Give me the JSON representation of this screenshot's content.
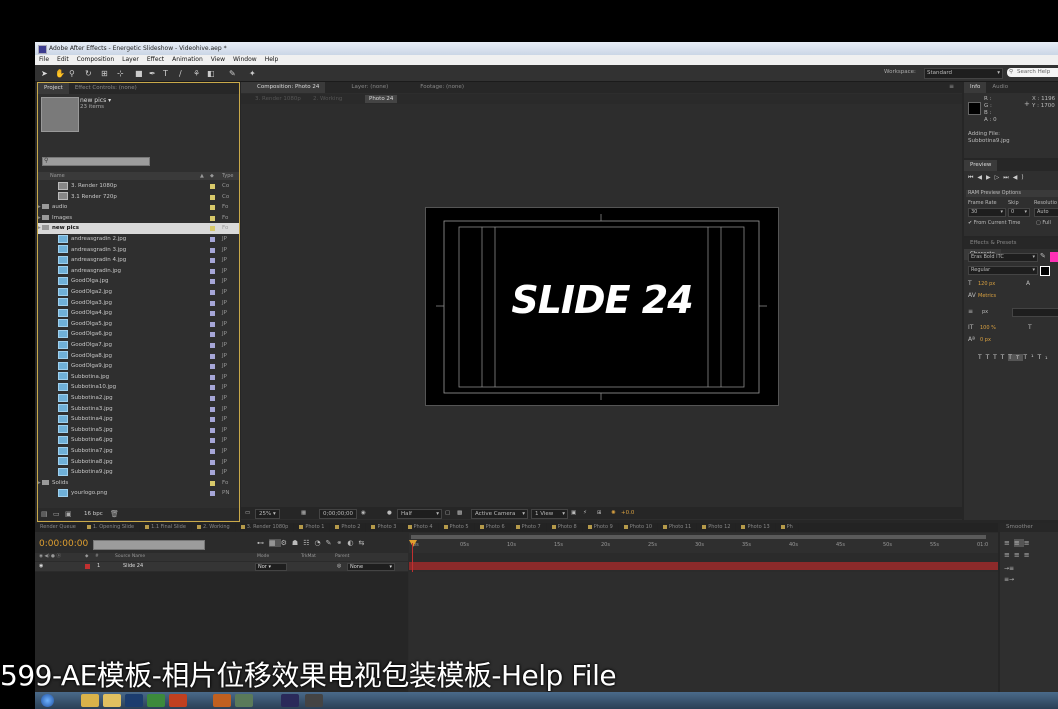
{
  "window": {
    "title": "Adobe After Effects - Energetic Slideshow - Videohive.aep *",
    "menu": [
      "File",
      "Edit",
      "Composition",
      "Layer",
      "Effect",
      "Animation",
      "View",
      "Window",
      "Help"
    ],
    "workspace_label": "Workspace:",
    "workspace_value": "Standard",
    "search_placeholder": "Search Help"
  },
  "project": {
    "tabs": [
      "Project",
      "Effect Controls: (none)"
    ],
    "selected_name": "new pics ▾",
    "selected_count": "23 items",
    "col_name": "Name",
    "col_type": "Type",
    "items": [
      {
        "name": "3. Render 1080p",
        "kind": "comp",
        "indent": 2,
        "type": "Co",
        "label": "y"
      },
      {
        "name": "3.1 Render 720p",
        "kind": "comp",
        "indent": 2,
        "type": "Co",
        "label": "y"
      },
      {
        "name": "audio",
        "kind": "folder",
        "indent": 0,
        "type": "Fo",
        "label": "y"
      },
      {
        "name": "Images",
        "kind": "folder",
        "indent": 0,
        "type": "Fo",
        "label": "y"
      },
      {
        "name": "new pics",
        "kind": "folder",
        "indent": 0,
        "type": "Fo",
        "label": "y",
        "selected": true
      },
      {
        "name": "andreasgradin 2.jpg",
        "kind": "img",
        "indent": 1,
        "type": "JP",
        "label": "p"
      },
      {
        "name": "andreasgradin 3.jpg",
        "kind": "img",
        "indent": 1,
        "type": "JP",
        "label": "p"
      },
      {
        "name": "andreasgradin 4.jpg",
        "kind": "img",
        "indent": 1,
        "type": "JP",
        "label": "p"
      },
      {
        "name": "andreasgradin.jpg",
        "kind": "img",
        "indent": 1,
        "type": "JP",
        "label": "p"
      },
      {
        "name": "GoodOlga.jpg",
        "kind": "img",
        "indent": 1,
        "type": "JP",
        "label": "p"
      },
      {
        "name": "GoodOlga2.jpg",
        "kind": "img",
        "indent": 1,
        "type": "JP",
        "label": "p"
      },
      {
        "name": "GoodOlga3.jpg",
        "kind": "img",
        "indent": 1,
        "type": "JP",
        "label": "p"
      },
      {
        "name": "GoodOlga4.jpg",
        "kind": "img",
        "indent": 1,
        "type": "JP",
        "label": "p"
      },
      {
        "name": "GoodOlga5.jpg",
        "kind": "img",
        "indent": 1,
        "type": "JP",
        "label": "p"
      },
      {
        "name": "GoodOlga6.jpg",
        "kind": "img",
        "indent": 1,
        "type": "JP",
        "label": "p"
      },
      {
        "name": "GoodOlga7.jpg",
        "kind": "img",
        "indent": 1,
        "type": "JP",
        "label": "p"
      },
      {
        "name": "GoodOlga8.jpg",
        "kind": "img",
        "indent": 1,
        "type": "JP",
        "label": "p"
      },
      {
        "name": "GoodOlga9.jpg",
        "kind": "img",
        "indent": 1,
        "type": "JP",
        "label": "p"
      },
      {
        "name": "Subbotina.jpg",
        "kind": "img",
        "indent": 1,
        "type": "JP",
        "label": "p"
      },
      {
        "name": "Subbotina10.jpg",
        "kind": "img",
        "indent": 1,
        "type": "JP",
        "label": "p"
      },
      {
        "name": "Subbotina2.jpg",
        "kind": "img",
        "indent": 1,
        "type": "JP",
        "label": "p"
      },
      {
        "name": "Subbotina3.jpg",
        "kind": "img",
        "indent": 1,
        "type": "JP",
        "label": "p"
      },
      {
        "name": "Subbotina4.jpg",
        "kind": "img",
        "indent": 1,
        "type": "JP",
        "label": "p"
      },
      {
        "name": "Subbotina5.jpg",
        "kind": "img",
        "indent": 1,
        "type": "JP",
        "label": "p"
      },
      {
        "name": "Subbotina6.jpg",
        "kind": "img",
        "indent": 1,
        "type": "JP",
        "label": "p"
      },
      {
        "name": "Subbotina7.jpg",
        "kind": "img",
        "indent": 1,
        "type": "JP",
        "label": "p"
      },
      {
        "name": "Subbotina8.jpg",
        "kind": "img",
        "indent": 1,
        "type": "JP",
        "label": "p"
      },
      {
        "name": "Subbotina9.jpg",
        "kind": "img",
        "indent": 1,
        "type": "JP",
        "label": "p"
      },
      {
        "name": "Solids",
        "kind": "folder",
        "indent": 0,
        "type": "Fo",
        "label": "y"
      },
      {
        "name": "yourlogo.png",
        "kind": "img",
        "indent": 0,
        "type": "PN",
        "label": "p"
      }
    ],
    "bpc": "16 bpc"
  },
  "composition": {
    "tabs": [
      "Composition: Photo 24",
      "Layer: (none)",
      "Footage: (none)"
    ],
    "breadcrumbs": [
      "3. Render 1080p",
      "2. Working",
      "Photo 24"
    ],
    "slide_text": "SLIDE 24",
    "zoom": "25%",
    "timecode": "0;00;00;00",
    "resolution": "Half",
    "camera": "Active Camera",
    "views": "1 View",
    "exposure": "+0.0"
  },
  "info": {
    "tabs": [
      "Info",
      "Audio"
    ],
    "r": "R :",
    "g": "G :",
    "b": "B :",
    "a": "A : 0",
    "x": "X : 1196",
    "y": "Y : 1700",
    "adding_file_label": "Adding File:",
    "adding_file": "Subbotina9.jpg"
  },
  "preview": {
    "tab": "Preview",
    "ram_options": "RAM Preview Options",
    "frame_rate_label": "Frame Rate",
    "skip_label": "Skip",
    "resolution_label": "Resolutio",
    "frame_rate": "30",
    "skip": "0",
    "resolution": "Auto",
    "from_current": "From Current Time",
    "full": "Full"
  },
  "character": {
    "tabs": [
      "Effects & Presets",
      "Characte"
    ],
    "font": "Eras Bold ITC",
    "style": "Regular",
    "size": "120 px",
    "tracking": "Metrics",
    "units": "px",
    "scale_v": "100 %",
    "baseline": "0 px",
    "swatch_color": "#ff2fb5"
  },
  "timeline": {
    "tabs": [
      "Render Queue",
      "1. Opening Slide",
      "1.1 Final Slide",
      "2. Working",
      "3. Render 1080p",
      "Photo 1",
      "Photo 2",
      "Photo 3",
      "Photo 4",
      "Photo 5",
      "Photo 6",
      "Photo 7",
      "Photo 8",
      "Photo 9",
      "Photo 10",
      "Photo 11",
      "Photo 12",
      "Photo 13",
      "Ph"
    ],
    "timecode": "0:00:00:00",
    "col_source": "Source Name",
    "col_mode": "Mode",
    "col_trkmat": "TrkMat",
    "col_parent": "Parent",
    "layer_num": "1",
    "layer_name": "Slide 24",
    "layer_mode": "Nor",
    "layer_parent": "None",
    "ruler": [
      "0s",
      "05s",
      "10s",
      "15s",
      "20s",
      "25s",
      "30s",
      "35s",
      "40s",
      "45s",
      "50s",
      "55s",
      "01:0"
    ],
    "smoother_tab": "Smoother"
  },
  "subtitle": "599-AE模板-相片位移效果电视包装模板-Help File"
}
